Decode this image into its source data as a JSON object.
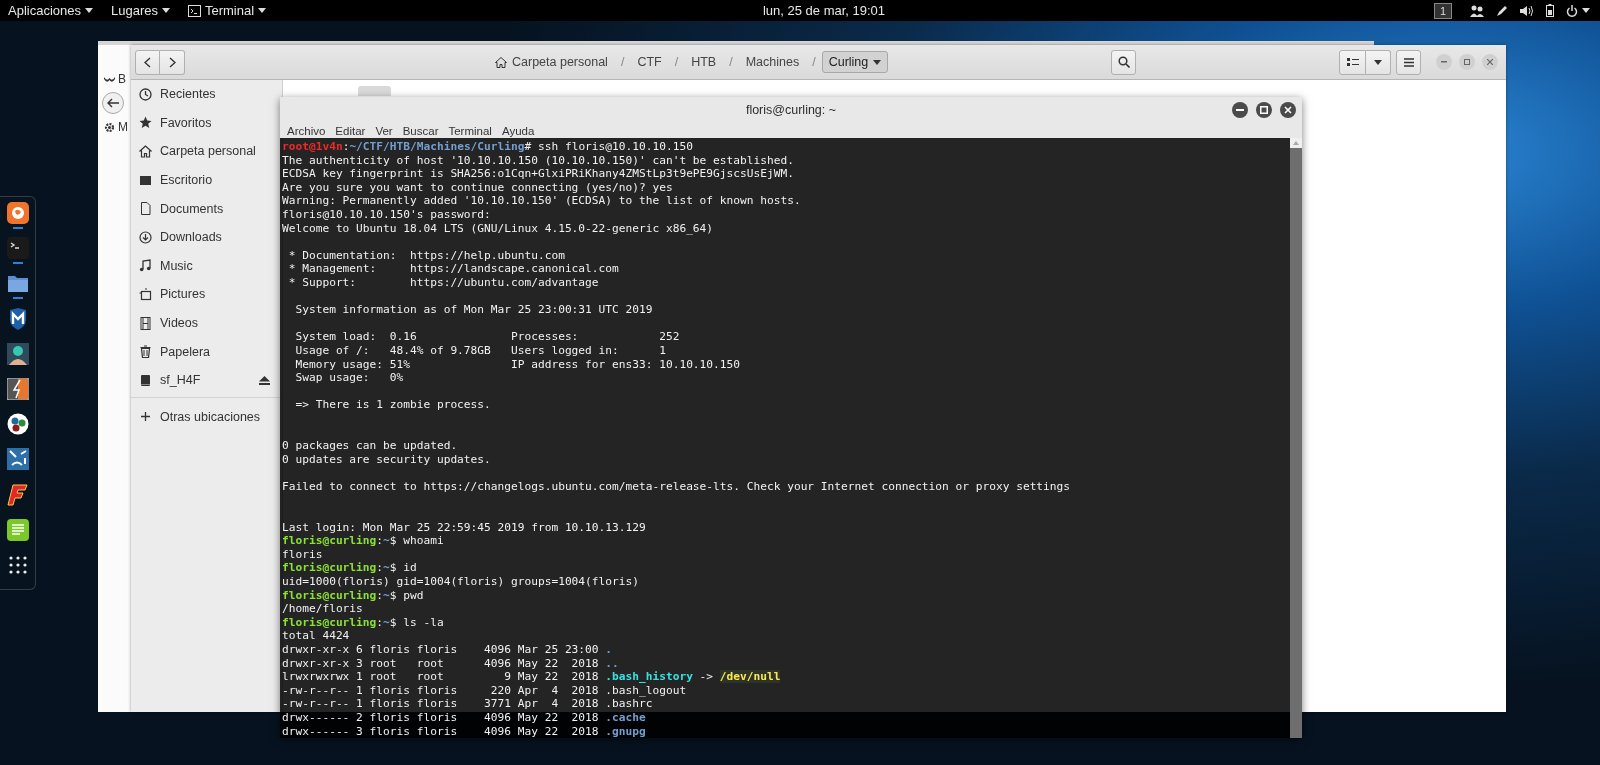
{
  "top_bar": {
    "menus": [
      {
        "label": "Aplicaciones",
        "kind": "menu"
      },
      {
        "label": "Lugares",
        "kind": "menu"
      },
      {
        "label": "Terminal",
        "kind": "app"
      }
    ],
    "clock": "lun, 25 de mar, 19:01",
    "workspace": "1"
  },
  "dock": {
    "items": [
      {
        "kind": "browser",
        "running": true
      },
      {
        "kind": "terminal",
        "running": true
      },
      {
        "kind": "folder",
        "running": true
      },
      {
        "kind": "shield",
        "running": false
      },
      {
        "kind": "avatar",
        "running": false
      },
      {
        "kind": "lightning",
        "running": false
      },
      {
        "kind": "dots",
        "running": false
      },
      {
        "kind": "abstract",
        "running": false
      },
      {
        "kind": "slanted",
        "running": false
      },
      {
        "kind": "notes",
        "running": false
      },
      {
        "kind": "grid",
        "running": false
      }
    ]
  },
  "back_window": {
    "fragments": [
      {
        "kind": "wave",
        "text": "B"
      },
      {
        "kind": "back"
      },
      {
        "kind": "gear",
        "text": "M"
      }
    ]
  },
  "file_manager": {
    "path": [
      {
        "label": "Carpeta personal",
        "kind": "home",
        "selected": false
      },
      {
        "label": "CTF",
        "separator": "/",
        "kind": "folder",
        "selected": false
      },
      {
        "label": "HTB",
        "separator": "/",
        "kind": "folder",
        "selected": false
      },
      {
        "label": "Machines",
        "separator": "/",
        "kind": "folder",
        "selected": false
      },
      {
        "label": "Curling",
        "separator": "/",
        "kind": "folder",
        "selected": true
      }
    ],
    "sidebar": [
      {
        "label": "Recientes",
        "kind": "recent",
        "selected": false
      },
      {
        "label": "Favoritos",
        "kind": "star",
        "selected": false
      },
      {
        "label": "Carpeta personal",
        "kind": "home",
        "selected": false
      },
      {
        "label": "Escritorio",
        "kind": "desktop",
        "selected": false
      },
      {
        "label": "Documents",
        "kind": "document",
        "selected": false
      },
      {
        "label": "Downloads",
        "kind": "download",
        "selected": false
      },
      {
        "label": "Music",
        "kind": "music",
        "selected": false
      },
      {
        "label": "Pictures",
        "kind": "pictures",
        "selected": false
      },
      {
        "label": "Videos",
        "kind": "video",
        "selected": false
      },
      {
        "label": "Papelera",
        "kind": "trash",
        "selected": false
      },
      {
        "label": "sf_H4F",
        "kind": "drive",
        "ejectable": true,
        "selected": false
      }
    ],
    "other_locations": {
      "label": "Otras ubicaciones",
      "selected": false
    }
  },
  "terminal": {
    "title": "floris@curling: ~",
    "menu": [
      "Archivo",
      "Editar",
      "Ver",
      "Buscar",
      "Terminal",
      "Ayuda"
    ],
    "lines": [
      {
        "kind": "text",
        "segments": [
          {
            "text": "root@1v4n",
            "kind": "root_user"
          },
          {
            "text": ":",
            "kind": "plain"
          },
          {
            "text": "~/CTF/HTB/Machines/Curling",
            "kind": "path"
          },
          {
            "text": "# ssh floris@10.10.10.150",
            "kind": "plain"
          }
        ]
      },
      {
        "kind": "text",
        "segments": [
          {
            "text": "The authenticity of host '10.10.10.150 (10.10.10.150)' can't be established.",
            "kind": "plain"
          }
        ]
      },
      {
        "kind": "text",
        "segments": [
          {
            "text": "ECDSA key fingerprint is SHA256:o1Cqn+GlxiPRiKhany4ZMStLp3t9ePE9GjscsUsEjWM.",
            "kind": "plain"
          }
        ]
      },
      {
        "kind": "text",
        "segments": [
          {
            "text": "Are you sure you want to continue connecting (yes/no)? yes",
            "kind": "plain"
          }
        ]
      },
      {
        "kind": "text",
        "segments": [
          {
            "text": "Warning: Permanently added '10.10.10.150' (ECDSA) to the list of known hosts.",
            "kind": "plain"
          }
        ]
      },
      {
        "kind": "text",
        "segments": [
          {
            "text": "floris@10.10.10.150's password:",
            "kind": "plain"
          }
        ]
      },
      {
        "kind": "text",
        "segments": [
          {
            "text": "Welcome to Ubuntu 18.04 LTS (GNU/Linux 4.15.0-22-generic x86_64)",
            "kind": "plain"
          }
        ]
      },
      {
        "kind": "blank"
      },
      {
        "kind": "text",
        "segments": [
          {
            "text": " * Documentation:  https://help.ubuntu.com",
            "kind": "plain"
          }
        ]
      },
      {
        "kind": "text",
        "segments": [
          {
            "text": " * Management:     https://landscape.canonical.com",
            "kind": "plain"
          }
        ]
      },
      {
        "kind": "text",
        "segments": [
          {
            "text": " * Support:        https://ubuntu.com/advantage",
            "kind": "plain"
          }
        ]
      },
      {
        "kind": "blank"
      },
      {
        "kind": "text",
        "segments": [
          {
            "text": "  System information as of Mon Mar 25 23:00:31 UTC 2019",
            "kind": "plain"
          }
        ]
      },
      {
        "kind": "blank"
      },
      {
        "kind": "text",
        "segments": [
          {
            "text": "  System load:  0.16              Processes:            252",
            "kind": "plain"
          }
        ]
      },
      {
        "kind": "text",
        "segments": [
          {
            "text": "  Usage of /:   48.4% of 9.78GB   Users logged in:      1",
            "kind": "plain"
          }
        ]
      },
      {
        "kind": "text",
        "segments": [
          {
            "text": "  Memory usage: 51%               IP address for ens33: 10.10.10.150",
            "kind": "plain"
          }
        ]
      },
      {
        "kind": "text",
        "segments": [
          {
            "text": "  Swap usage:   0%",
            "kind": "plain"
          }
        ]
      },
      {
        "kind": "blank"
      },
      {
        "kind": "text",
        "segments": [
          {
            "text": "  => There is 1 zombie process.",
            "kind": "plain"
          }
        ]
      },
      {
        "kind": "blank"
      },
      {
        "kind": "blank"
      },
      {
        "kind": "text",
        "segments": [
          {
            "text": "0 packages can be updated.",
            "kind": "plain"
          }
        ]
      },
      {
        "kind": "text",
        "segments": [
          {
            "text": "0 updates are security updates.",
            "kind": "plain"
          }
        ]
      },
      {
        "kind": "blank"
      },
      {
        "kind": "text",
        "segments": [
          {
            "text": "Failed to connect to https://changelogs.ubuntu.com/meta-release-lts. Check your Internet connection or proxy settings",
            "kind": "plain"
          }
        ]
      },
      {
        "kind": "blank"
      },
      {
        "kind": "blank"
      },
      {
        "kind": "text",
        "segments": [
          {
            "text": "Last login: Mon Mar 25 22:59:45 2019 from 10.10.13.129",
            "kind": "plain"
          }
        ]
      },
      {
        "kind": "text",
        "segments": [
          {
            "text": "floris@curling",
            "kind": "user"
          },
          {
            "text": ":",
            "kind": "plain"
          },
          {
            "text": "~",
            "kind": "path"
          },
          {
            "text": "$ whoami",
            "kind": "plain"
          }
        ]
      },
      {
        "kind": "text",
        "segments": [
          {
            "text": "floris",
            "kind": "plain"
          }
        ]
      },
      {
        "kind": "text",
        "segments": [
          {
            "text": "floris@curling",
            "kind": "user"
          },
          {
            "text": ":",
            "kind": "plain"
          },
          {
            "text": "~",
            "kind": "path"
          },
          {
            "text": "$ id",
            "kind": "plain"
          }
        ]
      },
      {
        "kind": "text",
        "segments": [
          {
            "text": "uid=1000(floris) gid=1004(floris) groups=1004(floris)",
            "kind": "plain"
          }
        ]
      },
      {
        "kind": "text",
        "segments": [
          {
            "text": "floris@curling",
            "kind": "user"
          },
          {
            "text": ":",
            "kind": "plain"
          },
          {
            "text": "~",
            "kind": "path"
          },
          {
            "text": "$ pwd",
            "kind": "plain"
          }
        ]
      },
      {
        "kind": "text",
        "segments": [
          {
            "text": "/home/floris",
            "kind": "plain"
          }
        ]
      },
      {
        "kind": "text",
        "segments": [
          {
            "text": "floris@curling",
            "kind": "user"
          },
          {
            "text": ":",
            "kind": "plain"
          },
          {
            "text": "~",
            "kind": "path"
          },
          {
            "text": "$ ls -la",
            "kind": "plain"
          }
        ]
      },
      {
        "kind": "text",
        "segments": [
          {
            "text": "total 4424",
            "kind": "plain"
          }
        ]
      },
      {
        "kind": "text",
        "segments": [
          {
            "text": "drwxr-xr-x 6 floris floris    4096 Mar 25 23:00 ",
            "kind": "plain"
          },
          {
            "text": ".",
            "kind": "dir"
          }
        ]
      },
      {
        "kind": "text",
        "segments": [
          {
            "text": "drwxr-xr-x 3 root   root      4096 May 22  2018 ",
            "kind": "plain"
          },
          {
            "text": "..",
            "kind": "dir"
          }
        ]
      },
      {
        "kind": "text",
        "segments": [
          {
            "text": "lrwxrwxrwx 1 root   root         9 May 22  2018 ",
            "kind": "plain"
          },
          {
            "text": ".bash_history",
            "kind": "link"
          },
          {
            "text": " -> ",
            "kind": "plain"
          },
          {
            "text": "/dev/null",
            "kind": "link_target"
          }
        ]
      },
      {
        "kind": "text",
        "segments": [
          {
            "text": "-rw-r--r-- 1 floris floris     220 Apr  4  2018 .bash_logout",
            "kind": "plain"
          }
        ]
      },
      {
        "kind": "text",
        "segments": [
          {
            "text": "-rw-r--r-- 1 floris floris    3771 Apr  4  2018 .bashrc",
            "kind": "plain"
          }
        ]
      },
      {
        "kind": "text",
        "segments": [
          {
            "text": "drwx------ 2 floris floris    4096 May 22  2018 ",
            "kind": "plain"
          },
          {
            "text": ".cache",
            "kind": "dir"
          }
        ]
      },
      {
        "kind": "text",
        "segments": [
          {
            "text": "drwx------ 3 floris floris    4096 May 22  2018 ",
            "kind": "plain"
          },
          {
            "text": ".gnupg",
            "kind": "dir"
          }
        ]
      }
    ]
  }
}
